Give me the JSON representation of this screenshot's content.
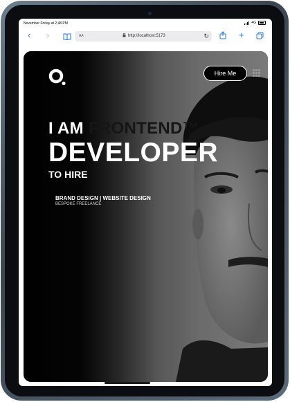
{
  "status_bar": {
    "time": "November Friday at 2:48 PM",
    "network": "4G"
  },
  "browser": {
    "text_size_label": "AA",
    "url": "http://localhost:5173",
    "icons": {
      "back": "chevron-left-icon",
      "forward": "chevron-right-icon",
      "bookmarks": "book-icon",
      "lock": "lock-icon",
      "reload": "reload-icon",
      "share": "share-icon",
      "new_tab": "plus-icon",
      "tabs": "tabs-icon"
    }
  },
  "site": {
    "nav": {
      "hire_label": "Hire Me",
      "menu_icon": "grid-menu-icon"
    },
    "hero": {
      "line1_prefix": "I AM",
      "line1_accent": "FRONTEND™",
      "line2": "DEVELOPER",
      "line3": "TO HIRE",
      "services": "BRAND DESIGN | WEBSITE DESIGN",
      "tagline": "BESPOKE FREELANCE"
    }
  },
  "colors": {
    "link_blue": "#1a7cf5",
    "hero_bg": "#000000",
    "accent_text": "#161616",
    "device_frame": "#4a5866"
  }
}
